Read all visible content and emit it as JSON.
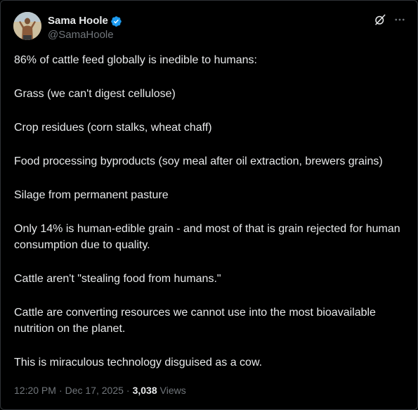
{
  "author": {
    "display_name": "Sama Hoole",
    "handle": "@SamaHoole",
    "verified": true,
    "verified_color": "#1d9bf0"
  },
  "header_icons": {
    "grok": "grok-icon",
    "more": "more-icon"
  },
  "post": {
    "paragraphs": [
      "86% of cattle feed globally is inedible to humans:",
      "Grass (we can't digest cellulose)",
      "Crop residues (corn stalks, wheat chaff)",
      "Food processing byproducts (soy meal after oil extraction, brewers grains)",
      "Silage from permanent pasture",
      "Only 14% is human-edible grain - and most of that is grain rejected for human consumption due to quality.",
      "Cattle aren't \"stealing food from humans.\"",
      "Cattle are converting resources we cannot use into the most bioavailable nutrition on the planet.",
      "This is miraculous technology disguised as a cow."
    ]
  },
  "meta": {
    "time": "12:20 PM",
    "separator": "·",
    "date": "Dec 17, 2025",
    "views_count": "3,038",
    "views_label": "Views"
  },
  "colors": {
    "background": "#000000",
    "text": "#e7e9ea",
    "secondary_text": "#71767b",
    "border": "#2f3336",
    "accent": "#1d9bf0"
  }
}
